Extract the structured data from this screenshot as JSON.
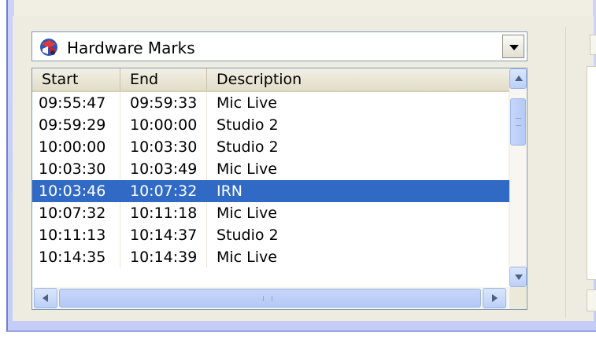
{
  "combo": {
    "icon": "hardware-marks-icon",
    "selected_value": "Hardware Marks"
  },
  "table": {
    "columns": [
      "Start",
      "End",
      "Description"
    ],
    "rows": [
      {
        "start": "09:55:47",
        "end": "09:59:33",
        "description": "Mic Live",
        "selected": false
      },
      {
        "start": "09:59:29",
        "end": "10:00:00",
        "description": "Studio 2",
        "selected": false
      },
      {
        "start": "10:00:00",
        "end": "10:03:30",
        "description": "Studio 2",
        "selected": false
      },
      {
        "start": "10:03:30",
        "end": "10:03:49",
        "description": "Mic Live",
        "selected": false
      },
      {
        "start": "10:03:46",
        "end": "10:07:32",
        "description": "IRN",
        "selected": true
      },
      {
        "start": "10:07:32",
        "end": "10:11:18",
        "description": "Mic Live",
        "selected": false
      },
      {
        "start": "10:11:13",
        "end": "10:14:37",
        "description": "Studio 2",
        "selected": false
      },
      {
        "start": "10:14:35",
        "end": "10:14:39",
        "description": "Mic Live",
        "selected": false
      }
    ]
  },
  "colors": {
    "selection": "#316ac5",
    "frame": "#c5cdf6"
  }
}
